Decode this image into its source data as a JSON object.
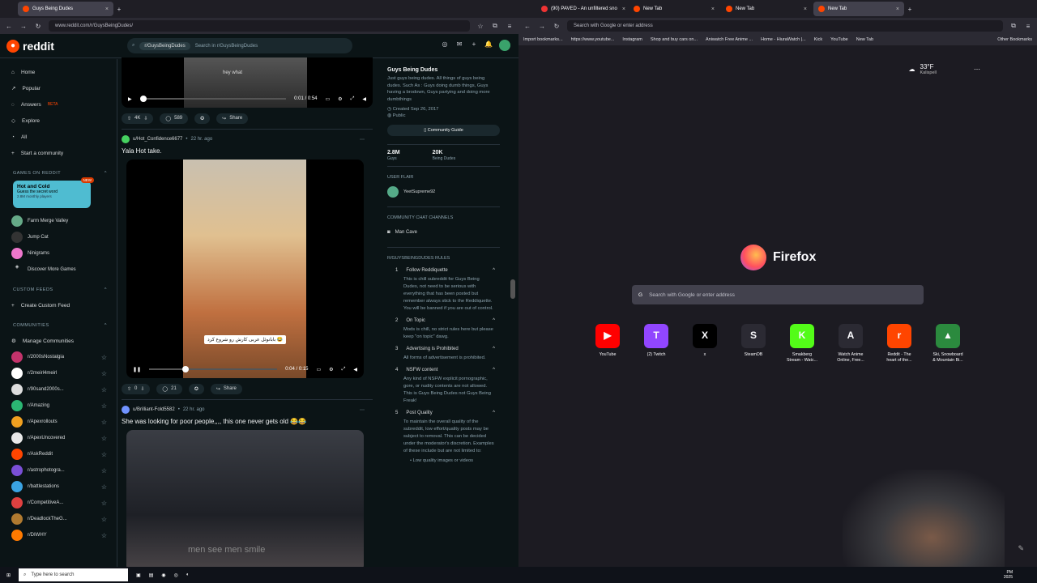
{
  "left_browser": {
    "tabs": [
      {
        "label": "Guys Being Dudes"
      }
    ],
    "url": "www.reddit.com/r/GuysBeingDudes/"
  },
  "reddit": {
    "logo": "reddit",
    "search_chip": "r/GuysBeingDudes",
    "search_placeholder": "Search in r/GuysBeingDudes",
    "nav": [
      "Home",
      "Popular",
      "Answers",
      "Explore",
      "All",
      "Start a community"
    ],
    "answers_badge": "BETA",
    "games_header": "GAMES ON REDDIT",
    "featured_game": {
      "title": "Hot and Cold",
      "subtitle": "Guess the secret word",
      "players": "2.8M monthly players",
      "badge": "NEW"
    },
    "games": [
      "Farm Merge Valley",
      "Jump Cat",
      "Ninigrams",
      "Discover More Games"
    ],
    "custom_feeds_header": "CUSTOM FEEDS",
    "create_feed": "Create Custom Feed",
    "communities_header": "COMMUNITIES",
    "manage_communities": "Manage Communities",
    "communities": [
      "r/2000sNostalgia",
      "r/2meirl4meirl",
      "r/90sand2000s...",
      "r/Amazing",
      "r/Apexrollouts",
      "r/ApexUncovered",
      "r/AskReddit",
      "r/astrophotogra...",
      "r/battlestations",
      "r/CompetitiveA...",
      "r/DeadlockTheG...",
      "r/DIWHY"
    ],
    "community_colors": [
      "#c3336b",
      "#ffffff",
      "#dddddd",
      "#2bb673",
      "#f0a020",
      "#e8e8e8",
      "#ff4500",
      "#7a4fd6",
      "#3aa3e3",
      "#e04040",
      "#b07a30",
      "#ff7a00"
    ]
  },
  "feed": {
    "post0": {
      "caption": "hey what",
      "time": "0:01 / 0:54",
      "upvotes": "4K",
      "comments": "589",
      "share": "Share"
    },
    "post1": {
      "user": "u/Hot_Confidence6677",
      "age": "22 hr. ago",
      "title": "Yala Hot take.",
      "overlay": "بابانوئل عربی کارش رو شروع کرد 😂",
      "time": "0:04 / 0:15",
      "upvotes": "0",
      "comments": "21",
      "share": "Share"
    },
    "post2": {
      "user": "u/Brilliant-Fold5582",
      "age": "22 hr. ago",
      "title": "She was looking for poor people,,,, this one never gets old 😂😂",
      "overlay": "men see men smile"
    }
  },
  "right_sidebar": {
    "name": "Guys Being Dudes",
    "description": "Just guys being dudes. All things of guys being dudes. Such As : Guys doing dumb things, Guys having a brodown, Guys partying and doing more dumbthings",
    "created": "Created Sep 26, 2017",
    "visibility": "Public",
    "guide_button": "Community Guide",
    "members": "2.8M",
    "members_label": "Guys",
    "online": "20K",
    "online_label": "Being Dudes",
    "flair_header": "USER FLAIR",
    "flair_user": "YeetSupreme92",
    "chat_header": "COMMUNITY CHAT CHANNELS",
    "chat_channel": "Man Cave",
    "rules_header": "R/GUYSBEINGDUDES RULES",
    "rules": [
      {
        "n": "1",
        "title": "Follow Reddiquette",
        "body": "This is chill subreddit for Guys Being Dudes, not need to be serious with everything that has been posted but remember always stick to the Reddiquette. You will be banned if you are out of control."
      },
      {
        "n": "2",
        "title": "On Topic",
        "body": "Mods is chill, no strict rules here but please keep \"on topic\" dawg."
      },
      {
        "n": "3",
        "title": "Advertising is Prohibited",
        "body": "All forms of advertisement is prohibited."
      },
      {
        "n": "4",
        "title": "NSFW content",
        "body": "Any kind of NSFW explicit pornographic, gore, or nudity contents are not allowed. This is Guys Being Dudes not Guys Being Freak!"
      },
      {
        "n": "5",
        "title": "Post Quality",
        "body": "To maintain the overall quality of the subreddit, low effort/quality posts may be subject to removal. This can be decided under the moderator's discretion. Examples of these include but are not limited to:"
      }
    ],
    "rule5_bullet": "Low quality images or videos"
  },
  "right_browser": {
    "tabs": [
      "(90) PAVED - An unfiltered sno",
      "New Tab",
      "New Tab",
      "New Tab"
    ],
    "url_placeholder": "Search with Google or enter address",
    "bookmarks": [
      "Import bookmarks...",
      "https://www.youtube...",
      "Instagram",
      "Shop and buy cars on...",
      "Aniwatch Free Anime ...",
      "Home - HiuraWatch |...",
      "Kick",
      "YouTube",
      "New Tab",
      "Other Bookmarks"
    ],
    "weather_temp": "33°F",
    "weather_city": "Kalispell",
    "brand": "Firefox",
    "search_placeholder": "Search with Google or enter address",
    "shortcuts": [
      {
        "label": "YouTube",
        "glyph": "▶",
        "color": "#ff0000"
      },
      {
        "label": "(2) Twitch",
        "glyph": "T",
        "color": "#9146ff"
      },
      {
        "label": "x",
        "glyph": "X",
        "color": "#000000"
      },
      {
        "label": "SteamDB",
        "glyph": "S",
        "color": "#2b2a33"
      },
      {
        "label": "Smakberg Stream - Watc...",
        "glyph": "K",
        "color": "#53fc18"
      },
      {
        "label": "Watch Anime Online, Free...",
        "glyph": "A",
        "color": "#2b2a33"
      },
      {
        "label": "Reddit - The heart of the...",
        "glyph": "r",
        "color": "#ff4500"
      },
      {
        "label": "Ski, Snowboard & Mountain Bi...",
        "glyph": "▲",
        "color": "#2b8a3e"
      }
    ]
  },
  "taskbar": {
    "search": "Type here to search",
    "time": "PM",
    "year": "2025"
  }
}
